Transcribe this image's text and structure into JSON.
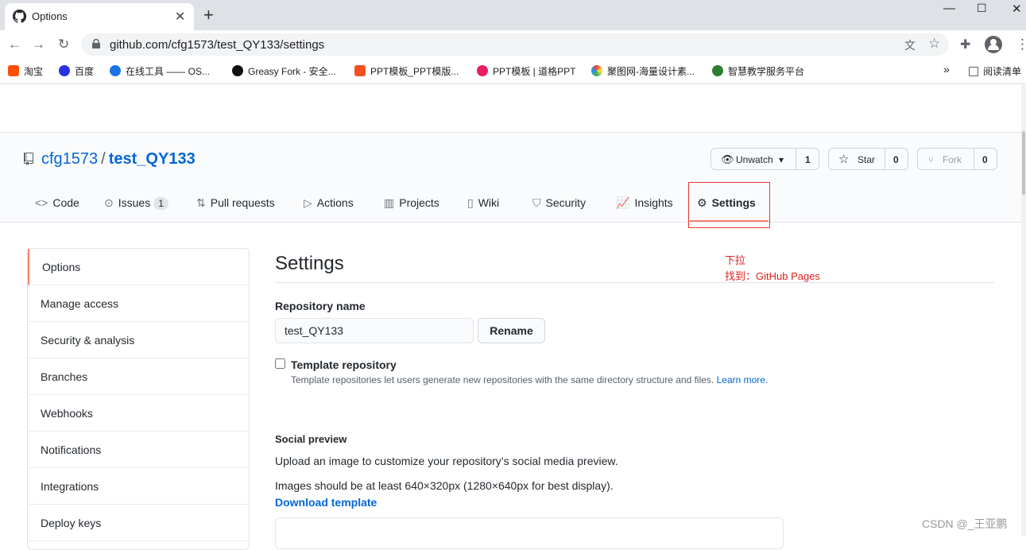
{
  "browser": {
    "tab_title": "Options",
    "url": "github.com/cfg1573/test_QY133/settings",
    "bookmarks": [
      "淘宝",
      "百度",
      "在线工具 —— OS...",
      "Greasy Fork - 安全...",
      "PPT模板_PPT模版...",
      "PPT模板 | 道格PPT",
      "聚图网-海量设计素...",
      "智慧教学服务平台"
    ],
    "reading_list": "阅读清单"
  },
  "repo": {
    "owner": "cfg1573",
    "separator": "/",
    "name": "test_QY133",
    "unwatch_label": "Unwatch",
    "watch_count": "1",
    "star_label": "Star",
    "star_count": "0",
    "fork_label": "Fork",
    "fork_count": "0"
  },
  "nav": {
    "code": "Code",
    "issues": "Issues",
    "issues_count": "1",
    "pulls": "Pull requests",
    "actions": "Actions",
    "projects": "Projects",
    "wiki": "Wiki",
    "security": "Security",
    "insights": "Insights",
    "settings": "Settings"
  },
  "sidebar": {
    "items": [
      "Options",
      "Manage access",
      "Security & analysis",
      "Branches",
      "Webhooks",
      "Notifications",
      "Integrations",
      "Deploy keys"
    ]
  },
  "content": {
    "title": "Settings",
    "annotation_line1": "下拉",
    "annotation_line2": "找到：GitHub Pages",
    "repo_name_label": "Repository name",
    "repo_name_value": "test_QY133",
    "rename_label": "Rename",
    "template_label": "Template repository",
    "template_desc": "Template repositories let users generate new repositories with the same directory structure and files.",
    "learn_more": "Learn more.",
    "social_title": "Social preview",
    "social_desc1": "Upload an image to customize your repository’s social media preview.",
    "social_desc2": "Images should be at least 640×320px (1280×640px for best display).",
    "download_template": "Download template"
  },
  "watermark": "CSDN @_王亚鹏",
  "colors": {
    "link": "#0366d6",
    "selected_border": "#f9826c",
    "annotation": "#e02020"
  }
}
